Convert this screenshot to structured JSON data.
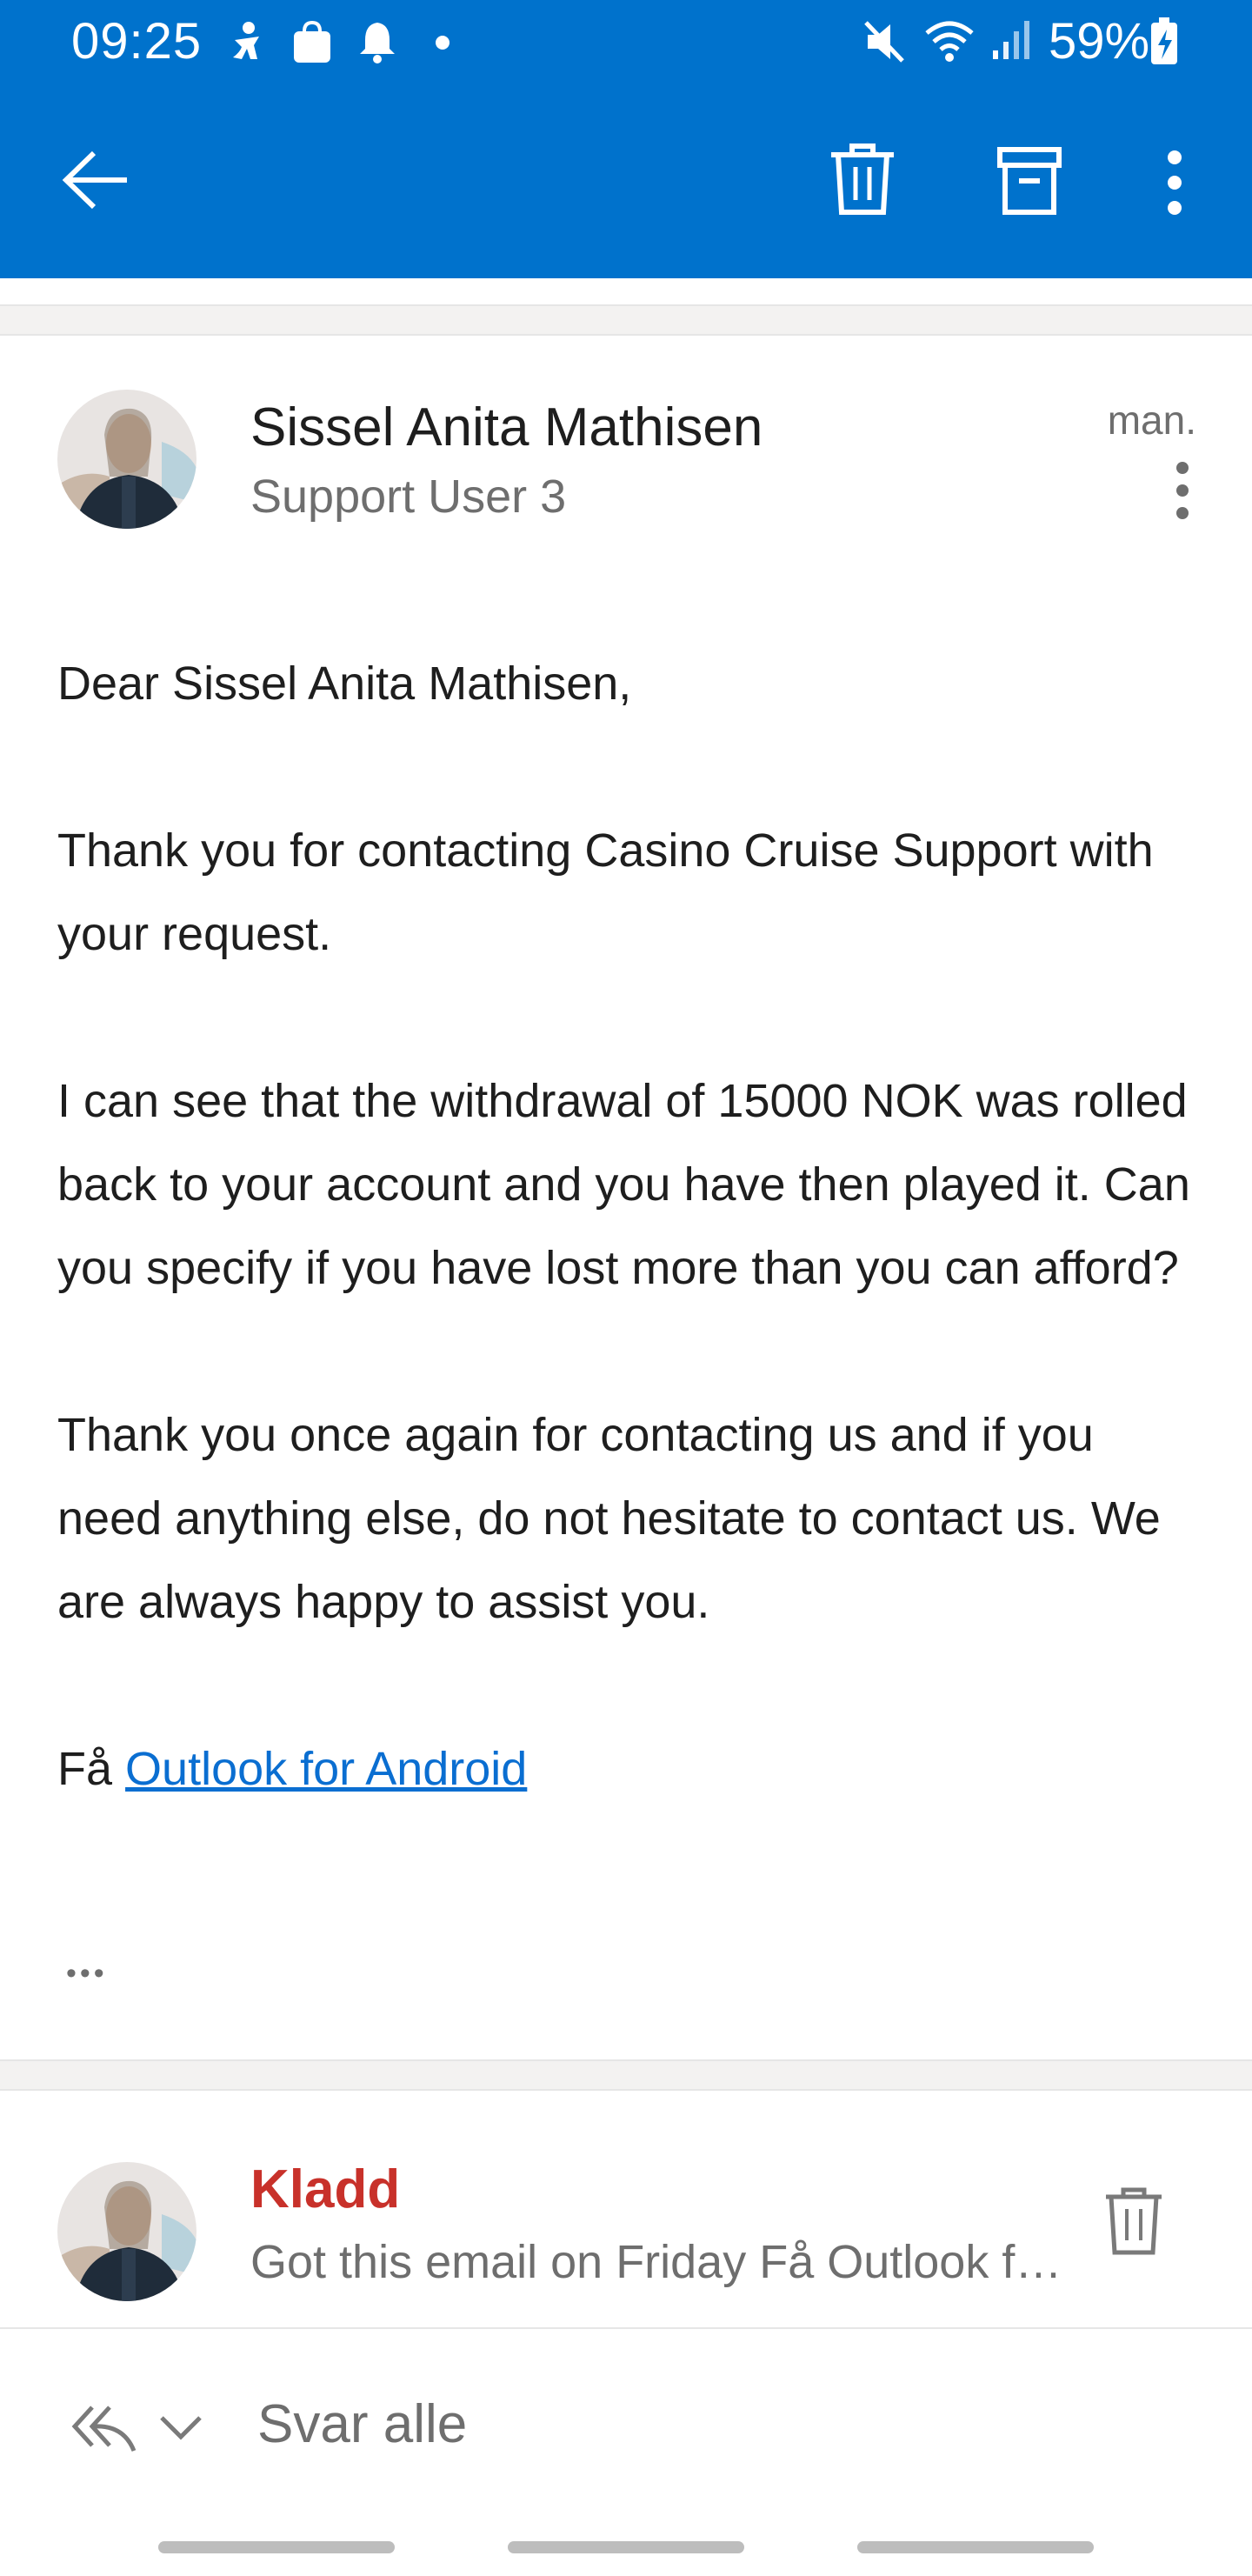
{
  "status_bar": {
    "time": "09:25",
    "battery": "59%",
    "icons": [
      "accessibility-icon",
      "bag-icon",
      "bell-icon",
      "dot-icon",
      "mute-icon",
      "wifi-icon",
      "signal-icon",
      "battery-icon"
    ]
  },
  "toolbar": {
    "icons": [
      "back-arrow-icon",
      "trash-icon",
      "archive-icon",
      "more-vertical-icon"
    ]
  },
  "message": {
    "sender_name": "Sissel Anita Mathisen",
    "sender_sub": "Support User 3",
    "date": "man.",
    "body": [
      "Dear Sissel Anita Mathisen,",
      "Thank you for contacting Casino Cruise Support with your request.",
      "I can see that the withdrawal of 15000 NOK was rolled back to your account and you have then played it. Can you specify if you have lost more than you can afford?",
      "Thank you once again for contacting us and if you need anything else, do not hesitate to contact us. We are always happy to assist you."
    ],
    "signature_prefix": "Få",
    "signature_link": "Outlook for Android",
    "ellipsis": "•••"
  },
  "draft": {
    "label": "Kladd",
    "preview": "Got this email on Friday Få Outlook for Android"
  },
  "reply": {
    "label": "Svar alle"
  },
  "colors": {
    "accent": "#0072CC",
    "draft_red": "#C8312A",
    "link": "#0A6ED1"
  }
}
